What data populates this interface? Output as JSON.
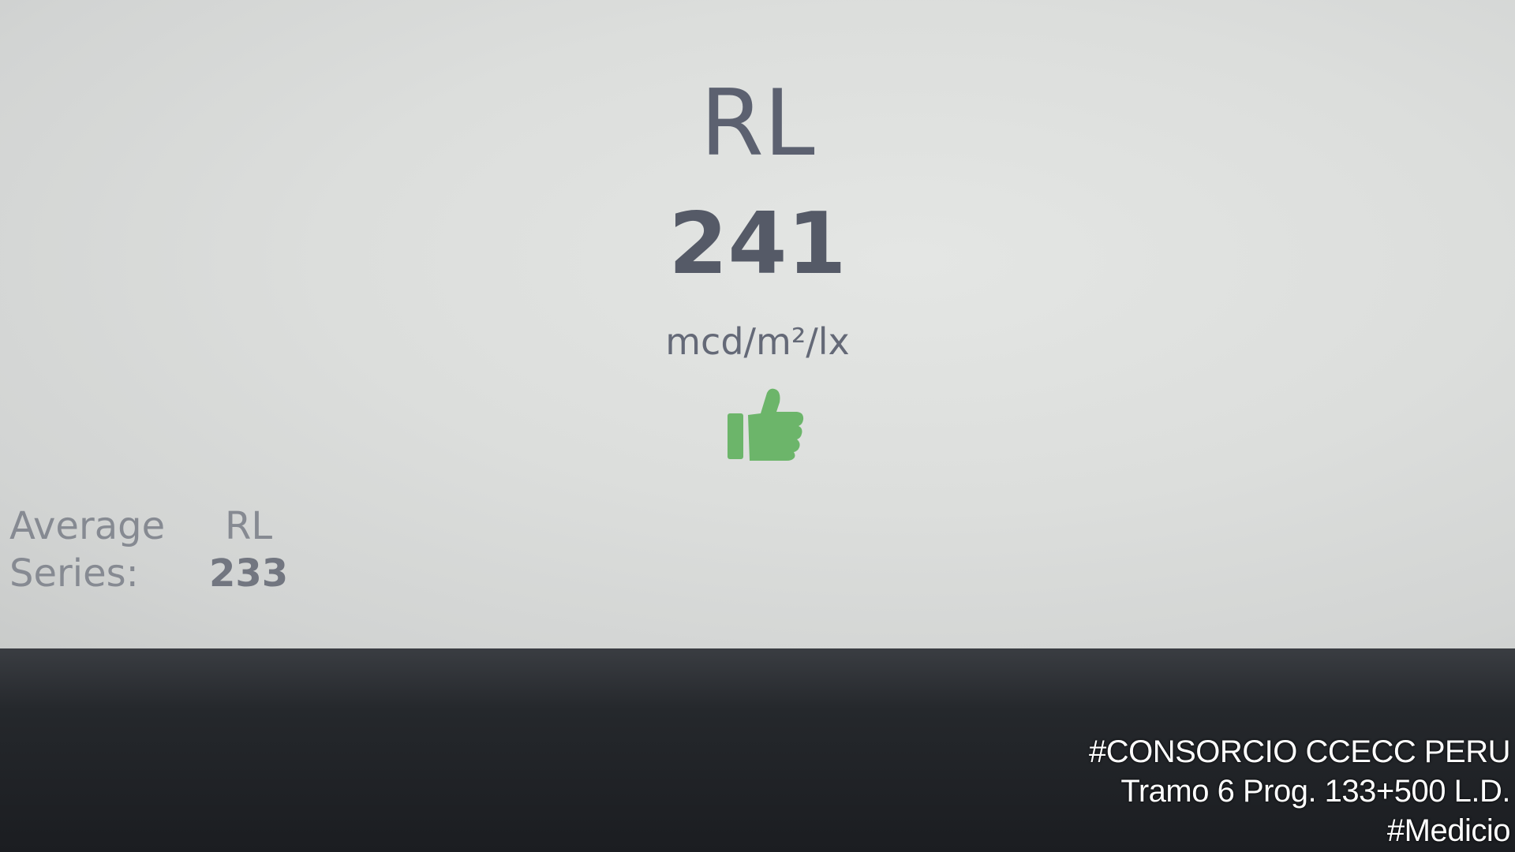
{
  "display": {
    "metric_label": "RL",
    "metric_value": "241",
    "metric_unit": "mcd/m²/lx",
    "status_icon": "thumbs-up-icon",
    "status_color": "#6cb56a"
  },
  "average": {
    "label_line1": "Average",
    "label_line2": "Series:",
    "metric": "RL",
    "value": "233"
  },
  "watermark": {
    "line1": "#CONSORCIO CCECC PERU",
    "line2": "Tramo 6 Prog. 133+500 L.D.",
    "line3": "#Medicio"
  }
}
